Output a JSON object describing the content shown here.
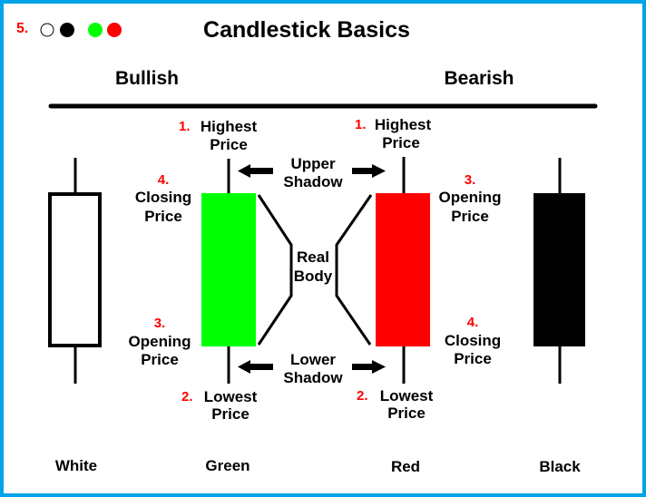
{
  "title": "Candlestick Basics",
  "legend": {
    "number": "5.",
    "dots": [
      {
        "name": "white",
        "fill": "#ffffff",
        "stroke": "#000000"
      },
      {
        "name": "black",
        "fill": "#000000",
        "stroke": "#000000"
      },
      {
        "name": "green",
        "fill": "#00ff00",
        "stroke": "#00ff00"
      },
      {
        "name": "red",
        "fill": "#ff0000",
        "stroke": "#ff0000"
      }
    ]
  },
  "sections": {
    "bullish": "Bullish",
    "bearish": "Bearish"
  },
  "colors": {
    "border": "#00a2e8",
    "green": "#00ff00",
    "red": "#ff0000",
    "black": "#000000",
    "white": "#ffffff",
    "number": "#ff0000"
  },
  "green_candle": {
    "top": {
      "number": "1.",
      "line1": "Highest",
      "line2": "Price"
    },
    "upper_body": {
      "number": "4.",
      "line1": "Closing",
      "line2": "Price"
    },
    "lower_body": {
      "number": "3.",
      "line1": "Opening",
      "line2": "Price"
    },
    "bottom": {
      "number": "2.",
      "line1": "Lowest",
      "line2": "Price"
    }
  },
  "red_candle": {
    "top": {
      "number": "1.",
      "line1": "Highest",
      "line2": "Price"
    },
    "upper_body": {
      "number": "3.",
      "line1": "Opening",
      "line2": "Price"
    },
    "lower_body": {
      "number": "4.",
      "line1": "Closing",
      "line2": "Price"
    },
    "bottom": {
      "number": "2.",
      "line1": "Lowest",
      "line2": "Price"
    }
  },
  "middle": {
    "upper_shadow": {
      "line1": "Upper",
      "line2": "Shadow"
    },
    "real_body": {
      "line1": "Real",
      "line2": "Body"
    },
    "lower_shadow": {
      "line1": "Lower",
      "line2": "Shadow"
    }
  },
  "candle_names": [
    "White",
    "Green",
    "Red",
    "Black"
  ]
}
